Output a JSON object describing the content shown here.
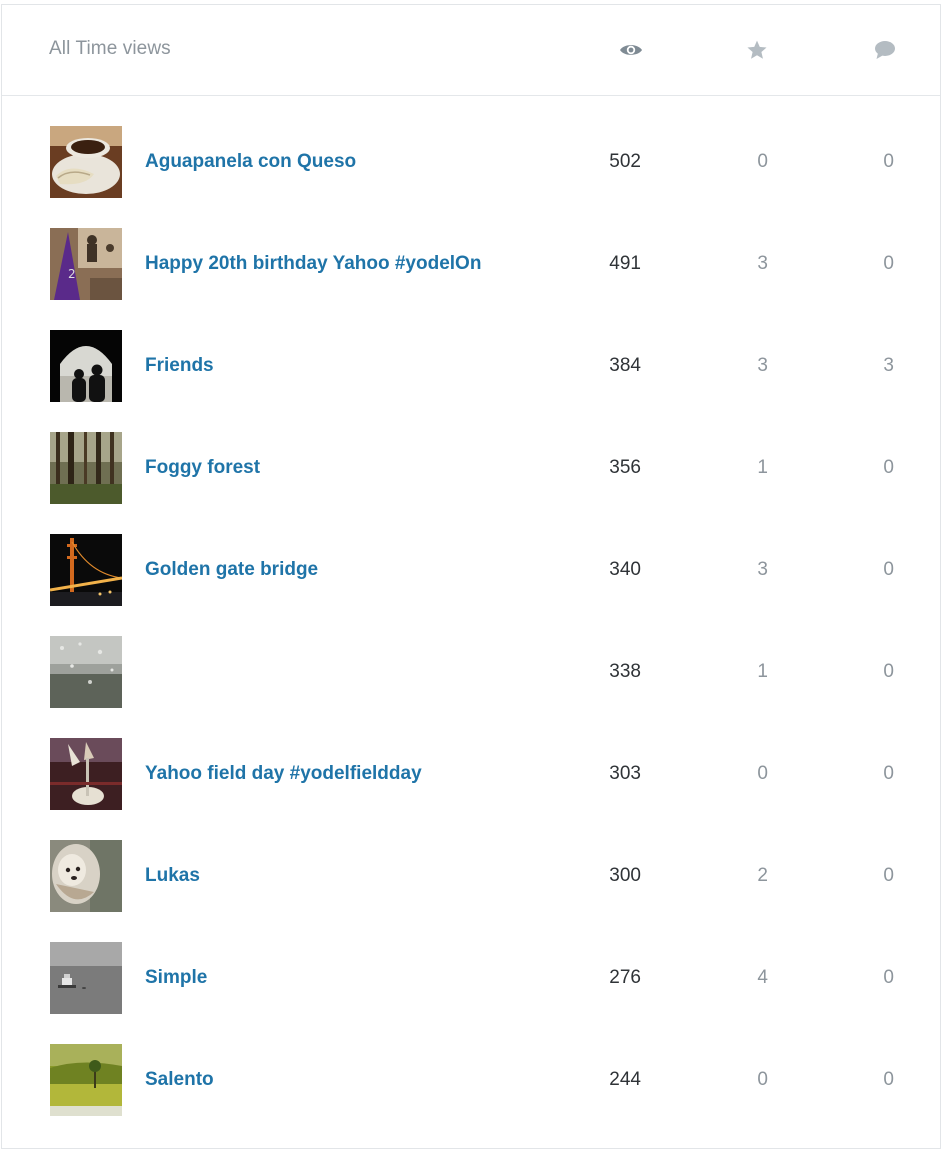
{
  "header": {
    "title": "All Time views",
    "columns": [
      {
        "icon": "eye-icon",
        "meaning": "views"
      },
      {
        "icon": "star-icon",
        "meaning": "faves"
      },
      {
        "icon": "comment-icon",
        "meaning": "comments"
      }
    ],
    "icon_color": "#9aa3aa"
  },
  "colors": {
    "title_link": "#1f74a8",
    "views_text": "#2f3337",
    "secondary_text": "#8d959c",
    "border": "#e2e5e8"
  },
  "rows": [
    {
      "title": "Aguapanela con Queso",
      "views": "502",
      "faves": "0",
      "comments": "0"
    },
    {
      "title": "Happy 20th birthday Yahoo #yodelOn",
      "views": "491",
      "faves": "3",
      "comments": "0"
    },
    {
      "title": "Friends",
      "views": "384",
      "faves": "3",
      "comments": "3"
    },
    {
      "title": "Foggy forest",
      "views": "356",
      "faves": "1",
      "comments": "0"
    },
    {
      "title": "Golden gate bridge",
      "views": "340",
      "faves": "3",
      "comments": "0"
    },
    {
      "title": "",
      "views": "338",
      "faves": "1",
      "comments": "0"
    },
    {
      "title": "Yahoo field day #yodelfieldday",
      "views": "303",
      "faves": "0",
      "comments": "0"
    },
    {
      "title": "Lukas",
      "views": "300",
      "faves": "2",
      "comments": "0"
    },
    {
      "title": "Simple",
      "views": "276",
      "faves": "4",
      "comments": "0"
    },
    {
      "title": "Salento",
      "views": "244",
      "faves": "0",
      "comments": "0"
    }
  ]
}
